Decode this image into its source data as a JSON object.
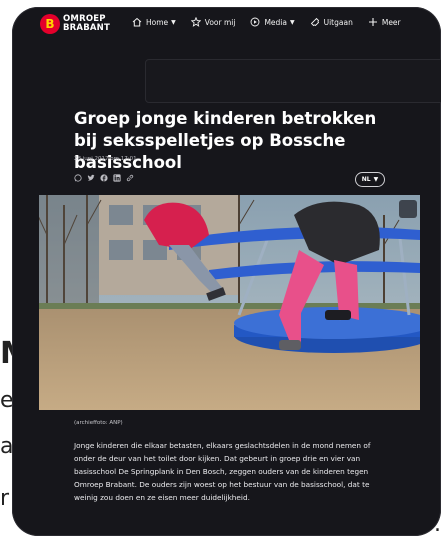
{
  "background": {
    "partial_texts": [
      "M",
      "e",
      "a",
      "r",
      "."
    ]
  },
  "brand": {
    "badge": "B",
    "line1": "OMROEP",
    "line2": "BRABANT",
    "badge_color": "#e4002b",
    "badge_text_color": "#ffd400"
  },
  "nav": [
    {
      "label": "Home",
      "icon": "home-icon",
      "has_dropdown": true
    },
    {
      "label": "Voor mij",
      "icon": "star-icon",
      "has_dropdown": false
    },
    {
      "label": "Media",
      "icon": "play-icon",
      "has_dropdown": true
    },
    {
      "label": "Uitgaan",
      "icon": "ticket-icon",
      "has_dropdown": false
    },
    {
      "label": "Meer",
      "icon": "plus-icon",
      "has_dropdown": false
    }
  ],
  "article": {
    "title": "Groep jonge kinderen betrokken bij seksspelletjes op Bossche basisschool",
    "date": "28 juni 2017 om 17:01",
    "language": "NL",
    "share_icons": [
      "whatsapp-icon",
      "twitter-icon",
      "facebook-icon",
      "linkedin-icon",
      "link-icon"
    ],
    "photo_caption": "(archieffoto: ANP)",
    "body": "Jonge kinderen die elkaar betasten, elkaars geslachtsdelen in de mond nemen of onder de deur van het toilet door kijken. Dat gebeurt in groep drie en vier van basisschool De Springplank in Den Bosch, zeggen ouders van de kinderen tegen Omroep Brabant. De ouders zijn woest op het bestuur van de basisschool, dat te weinig zou doen en ze eisen meer duidelijkheid."
  },
  "colors": {
    "page_background": "#16161b",
    "text": "#ffffff"
  }
}
